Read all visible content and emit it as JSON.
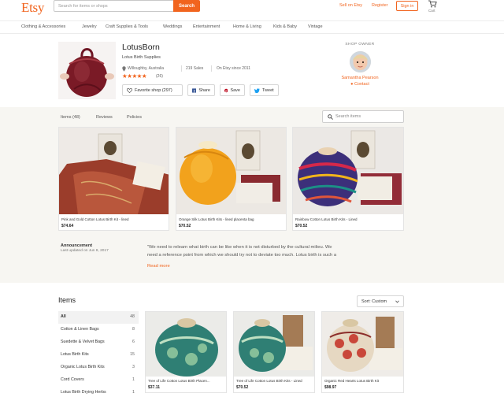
{
  "header": {
    "logo": "Etsy",
    "search_placeholder": "Search for items or shops",
    "search_button": "Search",
    "sell_link": "Sell on Etsy",
    "register_link": "Register",
    "signin_button": "Sign in",
    "cart_label": "Cart"
  },
  "categories": [
    "Clothing & Accessories",
    "Jewelry",
    "Craft Supplies & Tools",
    "Weddings",
    "Entertainment",
    "Home & Living",
    "Kids & Baby",
    "Vintage"
  ],
  "shop": {
    "name": "LotusBorn",
    "tagline": "Lotus Birth Supplies",
    "location": "Willoughby, Australia",
    "sales": "219 Sales",
    "since": "On Etsy since 2011",
    "stars": "★★★★★",
    "review_count": "(26)",
    "favorite_button": "Favorite shop (297)",
    "share_button": "Share",
    "save_button": "Save",
    "tweet_button": "Tweet"
  },
  "owner": {
    "label": "SHOP OWNER",
    "name": "Samantha Pearson",
    "contact": "Contact"
  },
  "tabs": [
    "Items (48)",
    "Reviews",
    "Policies"
  ],
  "section_search_placeholder": "Search items",
  "featured": [
    {
      "title": "Pink and Gold Cotton Lotus Birth Kit - lined",
      "price": "$74.64"
    },
    {
      "title": "Orange Silk Lotus Birth Kits - lined placenta bag",
      "price": "$70.52"
    },
    {
      "title": "Rainbow Cotton Lotus Birth Kits - Lined",
      "price": "$70.52"
    }
  ],
  "announcement": {
    "heading": "Announcement",
    "date": "Last updated on Jun 8, 2017",
    "lines": [
      "\"We need to relearn what birth can be like when it is not disturbed by the cultural milieu. We",
      "need a reference point from which we should try not to deviate too much. Lotus birth is such a"
    ],
    "read_more": "Read more"
  },
  "items": {
    "heading": "Items",
    "sort": "Sort: Custom",
    "sections": [
      {
        "label": "All",
        "count": "48"
      },
      {
        "label": "Cotton & Linen Bags",
        "count": "8"
      },
      {
        "label": "Suedette & Velvet Bags",
        "count": "6"
      },
      {
        "label": "Lotus Birth Kits",
        "count": "15"
      },
      {
        "label": "Organic Lotus Birth Kits",
        "count": "3"
      },
      {
        "label": "Cord Covers",
        "count": "1"
      },
      {
        "label": "Lotus Birth Drying Herbs",
        "count": "1"
      }
    ],
    "listings": [
      {
        "title": "Tree of Life Cotton Lotus Birth Placen...",
        "price": "$37.11"
      },
      {
        "title": "Tree of Life Cotton Lotus Birth Kits - Lined",
        "price": "$70.52"
      },
      {
        "title": "Organic Red Hearts Lotus Birth Kit",
        "price": "$98.97"
      }
    ]
  },
  "colors": {
    "accent": "#f1641e",
    "beige_bg": "#f7f6f2"
  }
}
